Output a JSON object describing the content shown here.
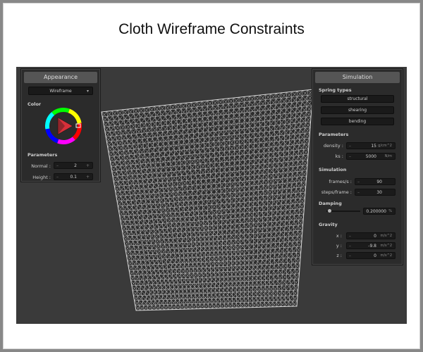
{
  "title": "Cloth Wireframe Constraints",
  "colors": {
    "background": "#3a3a3a",
    "panel": "#2b2b2b",
    "wire": "#e8e8e8",
    "accent": "#e8403a"
  },
  "appearance": {
    "header": "Appearance",
    "mode_value": "Wireframe",
    "color_label": "Color",
    "parameters_label": "Parameters",
    "normal_label": "Normal :",
    "normal_value": "2",
    "height_label": "Height :",
    "height_value": "0.1"
  },
  "simulation": {
    "header": "Simulation",
    "spring_types_label": "Spring types",
    "spring_buttons": [
      "structural",
      "shearing",
      "bending"
    ],
    "parameters_label": "Parameters",
    "density_label": "density :",
    "density_value": "15",
    "density_unit": "g/cm^2",
    "ks_label": "ks :",
    "ks_value": "5000",
    "ks_unit": "N/m",
    "simulation_label": "Simulation",
    "fps_label": "frames/s :",
    "fps_value": "90",
    "steps_label": "steps/frame :",
    "steps_value": "30",
    "damping_label": "Damping",
    "damping_value": "0.200000",
    "damping_unit": "%",
    "gravity_label": "Gravity",
    "gx_label": "x :",
    "gx_value": "0",
    "gy_label": "y :",
    "gy_value": "-9.8",
    "gz_label": "z :",
    "gz_value": "0",
    "gravity_unit": "m/s^2"
  }
}
